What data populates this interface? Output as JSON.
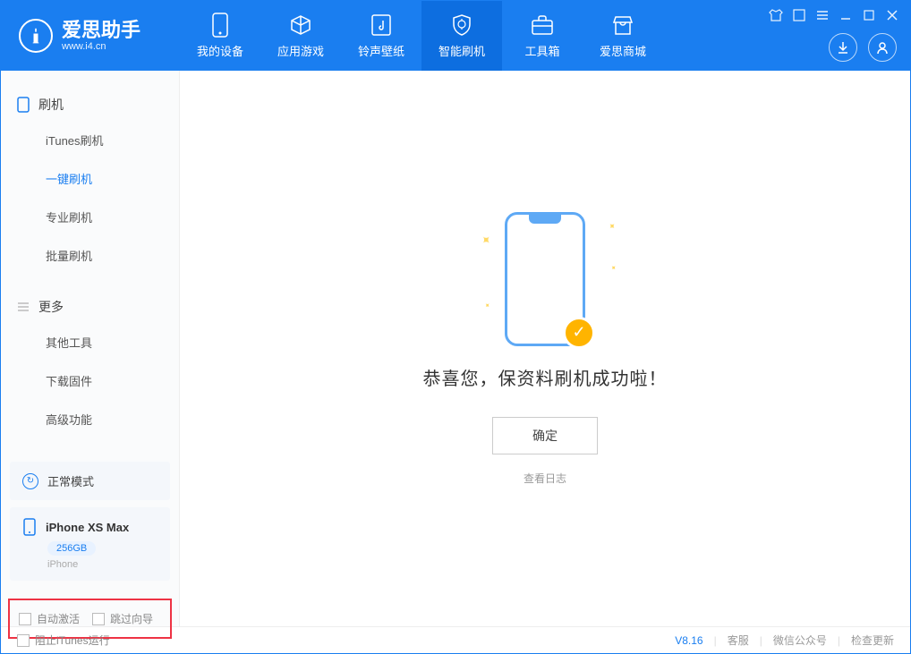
{
  "app": {
    "name": "爱思助手",
    "domain": "www.i4.cn"
  },
  "nav": {
    "my_device": "我的设备",
    "apps_games": "应用游戏",
    "ringtone_wallpaper": "铃声壁纸",
    "smart_flash": "智能刷机",
    "toolbox": "工具箱",
    "aisi_store": "爱思商城"
  },
  "sidebar": {
    "flash_section": "刷机",
    "flash_items": {
      "itunes": "iTunes刷机",
      "oneclick": "一键刷机",
      "pro": "专业刷机",
      "batch": "批量刷机"
    },
    "more_section": "更多",
    "more_items": {
      "other_tools": "其他工具",
      "download_firmware": "下载固件",
      "advanced": "高级功能"
    },
    "mode": "正常模式",
    "device": {
      "name": "iPhone XS Max",
      "storage": "256GB",
      "type": "iPhone"
    },
    "auto_activate": "自动激活",
    "skip_wizard": "跳过向导"
  },
  "main": {
    "success_message": "恭喜您，保资料刷机成功啦！",
    "ok_button": "确定",
    "view_log": "查看日志"
  },
  "footer": {
    "block_itunes": "阻止iTunes运行",
    "version": "V8.16",
    "support": "客服",
    "wechat": "微信公众号",
    "check_update": "检查更新"
  }
}
